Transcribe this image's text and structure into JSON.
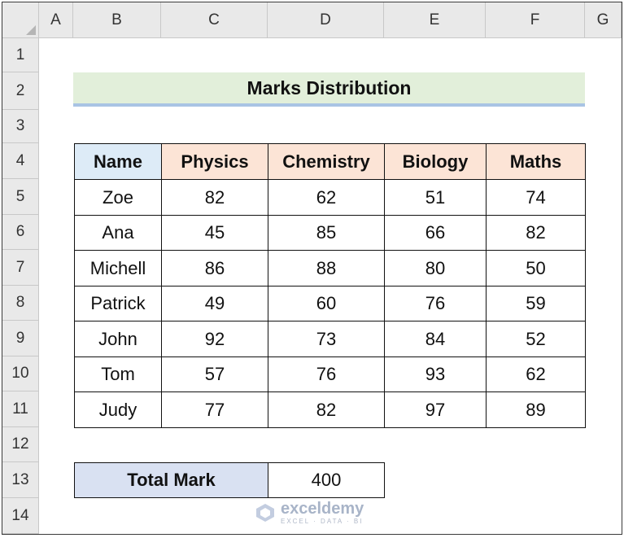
{
  "columns": [
    "A",
    "B",
    "C",
    "D",
    "E",
    "F",
    "G"
  ],
  "rows": [
    "1",
    "2",
    "3",
    "4",
    "5",
    "6",
    "7",
    "8",
    "9",
    "10",
    "11",
    "12",
    "13",
    "14"
  ],
  "title": "Marks Distribution",
  "table": {
    "headers": [
      "Name",
      "Physics",
      "Chemistry",
      "Biology",
      "Maths"
    ],
    "rows": [
      [
        "Zoe",
        "82",
        "62",
        "51",
        "74"
      ],
      [
        "Ana",
        "45",
        "85",
        "66",
        "82"
      ],
      [
        "Michell",
        "86",
        "88",
        "80",
        "50"
      ],
      [
        "Patrick",
        "49",
        "60",
        "76",
        "59"
      ],
      [
        "John",
        "92",
        "73",
        "84",
        "52"
      ],
      [
        "Tom",
        "57",
        "76",
        "93",
        "62"
      ],
      [
        "Judy",
        "77",
        "82",
        "97",
        "89"
      ]
    ]
  },
  "total": {
    "label": "Total Mark",
    "value": "400"
  },
  "watermark": {
    "name": "exceldemy",
    "tagline": "EXCEL · DATA · BI"
  },
  "colors": {
    "title_fill": "#e2efda",
    "title_underline": "#a9c4e4",
    "name_header_fill": "#ddebf7",
    "subject_header_fill": "#fce4d6",
    "total_label_fill": "#d9e1f2"
  }
}
